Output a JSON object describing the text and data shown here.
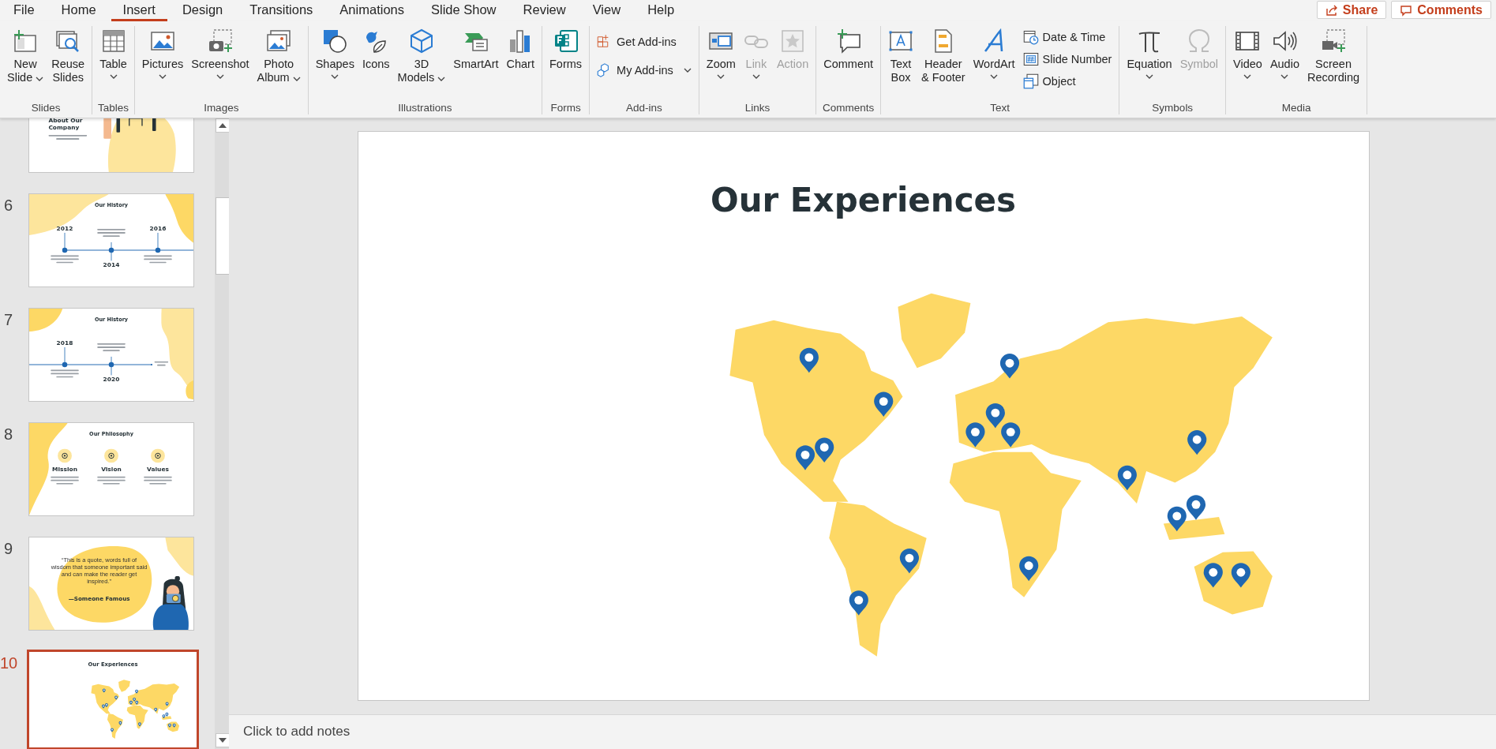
{
  "menu_tabs": [
    {
      "label": "File",
      "selected": false
    },
    {
      "label": "Home",
      "selected": false
    },
    {
      "label": "Insert",
      "selected": true
    },
    {
      "label": "Design",
      "selected": false
    },
    {
      "label": "Transitions",
      "selected": false
    },
    {
      "label": "Animations",
      "selected": false
    },
    {
      "label": "Slide Show",
      "selected": false
    },
    {
      "label": "Review",
      "selected": false
    },
    {
      "label": "View",
      "selected": false
    },
    {
      "label": "Help",
      "selected": false
    }
  ],
  "share_button": {
    "label": "Share"
  },
  "comments_button": {
    "label": "Comments"
  },
  "ribbon_groups": [
    {
      "label": "Slides",
      "commands": [
        {
          "label": "New\nSlide",
          "kind": "large",
          "dropdown": true,
          "disabled": false
        },
        {
          "label": "Reuse\nSlides",
          "kind": "large",
          "dropdown": false,
          "disabled": false
        }
      ]
    },
    {
      "label": "Tables",
      "commands": [
        {
          "label": "Table",
          "kind": "large",
          "dropdown": true,
          "disabled": false
        }
      ]
    },
    {
      "label": "Images",
      "commands": [
        {
          "label": "Pictures",
          "kind": "large",
          "dropdown": true,
          "disabled": false
        },
        {
          "label": "Screenshot",
          "kind": "large",
          "dropdown": true,
          "disabled": false
        },
        {
          "label": "Photo\nAlbum",
          "kind": "large",
          "dropdown": true,
          "disabled": false
        }
      ]
    },
    {
      "label": "Illustrations",
      "commands": [
        {
          "label": "Shapes",
          "kind": "large",
          "dropdown": true,
          "disabled": false
        },
        {
          "label": "Icons",
          "kind": "large",
          "dropdown": false,
          "disabled": false
        },
        {
          "label": "3D\nModels",
          "kind": "large",
          "dropdown": true,
          "disabled": false
        },
        {
          "label": "SmartArt",
          "kind": "large",
          "dropdown": false,
          "disabled": false
        },
        {
          "label": "Chart",
          "kind": "large",
          "dropdown": false,
          "disabled": false
        }
      ]
    },
    {
      "label": "Forms",
      "commands": [
        {
          "label": "Forms",
          "kind": "large",
          "dropdown": false,
          "disabled": false
        }
      ]
    },
    {
      "label": "Add-ins",
      "commands": [
        {
          "label": "Get Add-ins",
          "kind": "small",
          "dropdown": false,
          "disabled": false
        },
        {
          "label": "My Add-ins",
          "kind": "small",
          "dropdown": true,
          "disabled": false
        }
      ]
    },
    {
      "label": "Links",
      "commands": [
        {
          "label": "Zoom",
          "kind": "large",
          "dropdown": true,
          "disabled": false
        },
        {
          "label": "Link",
          "kind": "large",
          "dropdown": true,
          "disabled": true
        },
        {
          "label": "Action",
          "kind": "large",
          "dropdown": false,
          "disabled": true
        }
      ]
    },
    {
      "label": "Comments",
      "commands": [
        {
          "label": "Comment",
          "kind": "large",
          "dropdown": false,
          "disabled": false
        }
      ]
    },
    {
      "label": "Text",
      "commands": [
        {
          "label": "Text\nBox",
          "kind": "large",
          "dropdown": false,
          "disabled": false
        },
        {
          "label": "Header\n& Footer",
          "kind": "large",
          "dropdown": false,
          "disabled": false
        },
        {
          "label": "WordArt",
          "kind": "large",
          "dropdown": true,
          "disabled": false
        },
        {
          "label": "Date & Time",
          "kind": "small",
          "dropdown": false,
          "disabled": false
        },
        {
          "label": "Slide Number",
          "kind": "small",
          "dropdown": false,
          "disabled": false
        },
        {
          "label": "Object",
          "kind": "small",
          "dropdown": false,
          "disabled": false
        }
      ]
    },
    {
      "label": "Symbols",
      "commands": [
        {
          "label": "Equation",
          "kind": "large",
          "dropdown": true,
          "disabled": false
        },
        {
          "label": "Symbol",
          "kind": "large",
          "dropdown": false,
          "disabled": true
        }
      ]
    },
    {
      "label": "Media",
      "commands": [
        {
          "label": "Video",
          "kind": "large",
          "dropdown": true,
          "disabled": false
        },
        {
          "label": "Audio",
          "kind": "large",
          "dropdown": true,
          "disabled": false
        },
        {
          "label": "Screen\nRecording",
          "kind": "large",
          "dropdown": false,
          "disabled": false
        }
      ]
    }
  ],
  "slides": [
    {
      "selected": false,
      "kind": "intro",
      "title": "About Our Company"
    },
    {
      "number": "6",
      "selected": false,
      "kind": "timeline",
      "title": "Our History",
      "events": [
        {
          "year": "2012"
        },
        {
          "year": "2014"
        },
        {
          "year": "2016"
        }
      ],
      "arrow_end": false
    },
    {
      "number": "7",
      "selected": false,
      "kind": "timeline",
      "title": "Our History",
      "events": [
        {
          "year": "2018"
        },
        {
          "year": "2020"
        }
      ],
      "arrow_end": true
    },
    {
      "number": "8",
      "selected": false,
      "kind": "philosophy",
      "title": "Our Philosophy",
      "columns": [
        {
          "title": "Mission"
        },
        {
          "title": "Vision"
        },
        {
          "title": "Values"
        }
      ]
    },
    {
      "number": "9",
      "selected": false,
      "kind": "quote",
      "quote": "“This is a quote, words full of wisdom that someone important said and can make the reader get inspired.”",
      "author": "—Someone Famous"
    },
    {
      "number": "10",
      "selected": true,
      "kind": "map",
      "title": "Our Experiences"
    }
  ],
  "slide_editor": {
    "kind": "map",
    "title": "Our Experiences"
  },
  "notes": {
    "placeholder": "Click to add notes"
  }
}
